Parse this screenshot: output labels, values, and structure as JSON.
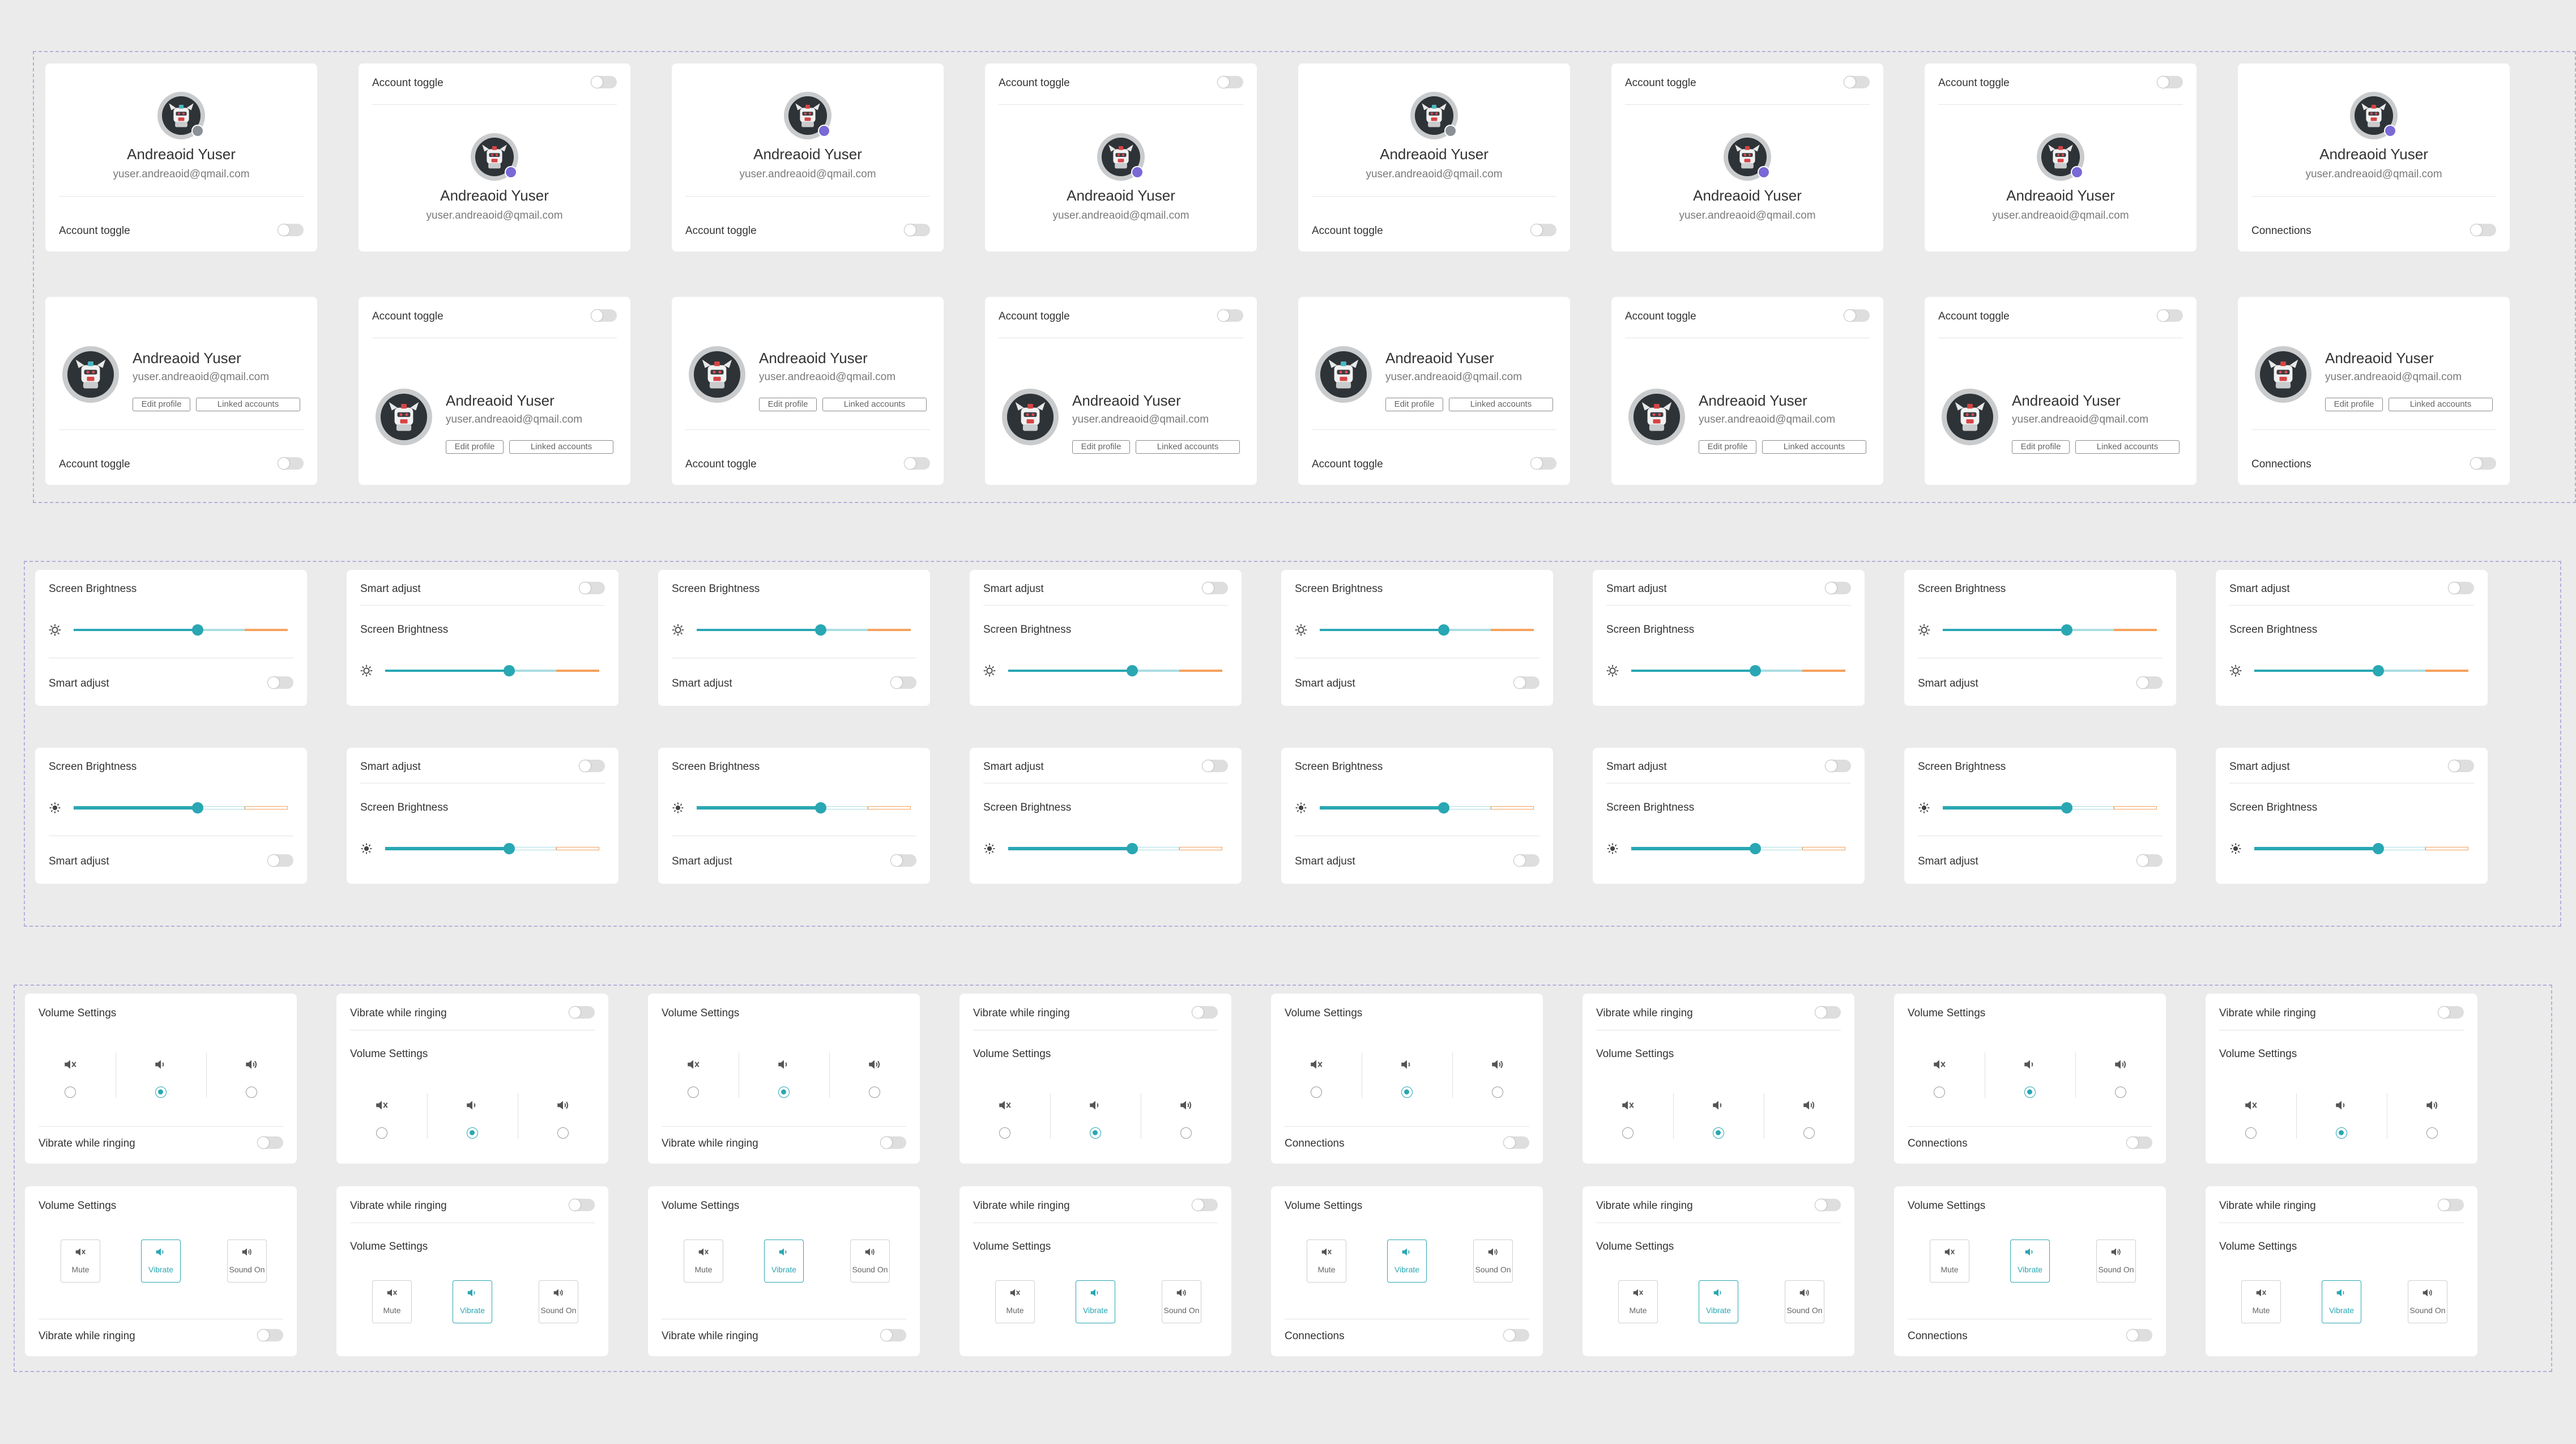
{
  "colors": {
    "background": "#ebebeb",
    "card": "#ffffff",
    "group_border": "#b2b0dc",
    "accent_teal": "#29a7b3",
    "accent_orange": "#f5a25d",
    "badge_purple": "#7a69d6",
    "toggle_off": "#dedede"
  },
  "profile": {
    "name": "Andreaoid Yuser",
    "email": "yuser.andreaoid@qmail.com",
    "edit_label": "Edit profile",
    "linked_label": "Linked accounts",
    "account_toggle": "Account toggle",
    "connections": "Connections"
  },
  "brightness": {
    "title": "Screen Brightness",
    "smart_adjust": "Smart adjust",
    "level": 0.58
  },
  "volume": {
    "title": "Volume Settings",
    "vibrate_ringing": "Vibrate while ringing",
    "connections": "Connections",
    "options": [
      "Mute",
      "Vibrate",
      "Sound On"
    ],
    "selected": "Vibrate",
    "icons": [
      "speaker-muted-icon",
      "speaker-vibrate-icon",
      "speaker-sound-icon"
    ]
  },
  "toggles_state": "off"
}
